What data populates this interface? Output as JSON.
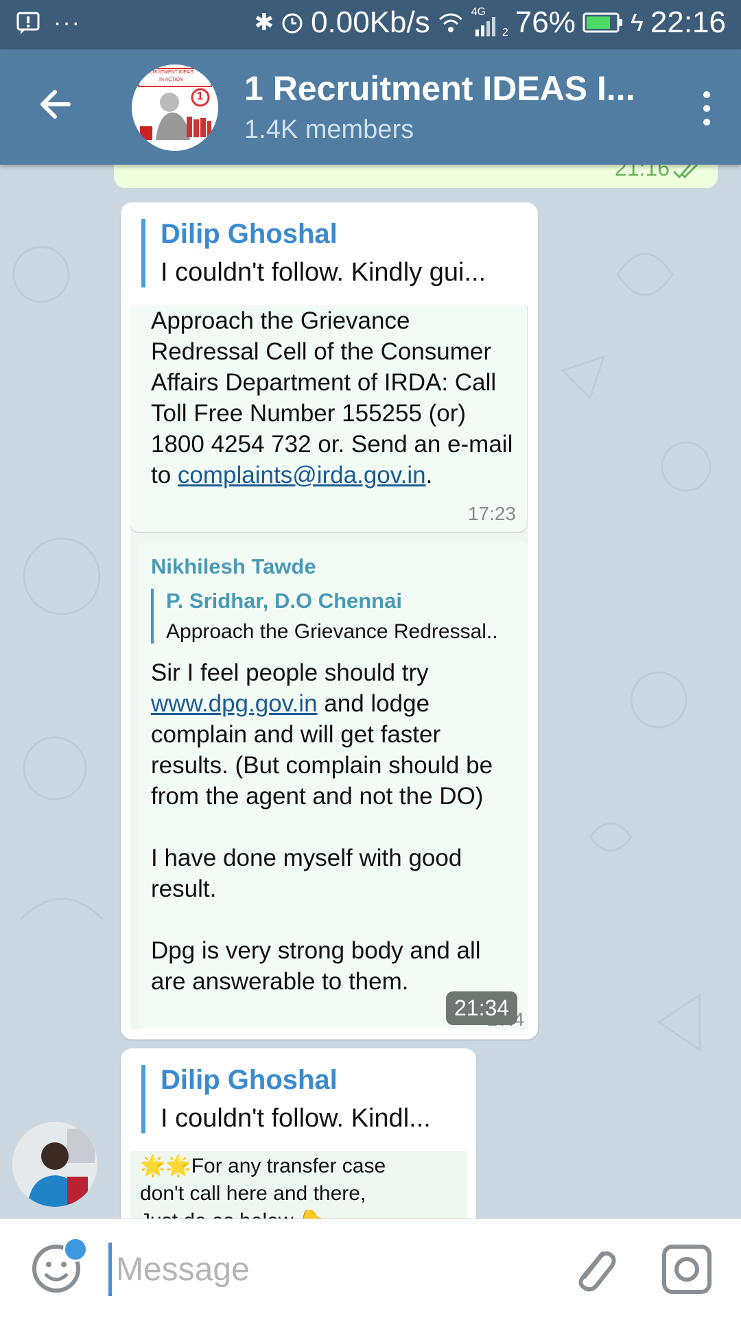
{
  "statusbar": {
    "network": "0.00Kb/s",
    "signal_label": "4G",
    "sim": "2",
    "battery": "76%",
    "time": "22:16"
  },
  "header": {
    "title": "1 Recruitment IDEAS I...",
    "subtitle": "1.4K members",
    "avatar_text_top": "RECRUITMENT IDEAS",
    "avatar_text_bottom": "IN ACTION",
    "avatar_badge": "1"
  },
  "outgoing": {
    "time": "21:16"
  },
  "messages": [
    {
      "reply_name": "Dilip Ghoshal",
      "reply_text": "I couldn't follow. Kindly gui...",
      "shot": {
        "paragraph_start": "Approach the Grievance Redressal Cell of the Consumer Affairs Department of IRDA: Call Toll Free Number 155255 (or) 1800 4254 732 or. Send an e-mail to ",
        "email": "complaints@irda.gov.in",
        "paragraph_end": ".",
        "time": "17:23",
        "inner": {
          "sender": "Nikhilesh Tawde",
          "nested_name": "P. Sridhar, D.O Chennai",
          "nested_text": "Approach the Grievance Redressal..",
          "line1_start": "Sir I feel people should try ",
          "line1_link": "www.dpg.gov.in",
          "line1_end": " and lodge complain and will get faster results. (But complain should be from the agent and not the DO)",
          "line2": "I have done myself with good result.",
          "line3": "Dpg is very strong body and all are answerable to them.",
          "faded_time": "17:4"
        }
      },
      "time": "21:34"
    },
    {
      "reply_name": "Dilip Ghoshal",
      "reply_text": "I couldn't follow. Kindl...",
      "shot_text": "🌟🌟For any transfer case don't call here and there,",
      "shot_text_cut": "Just do as below 👇"
    }
  ],
  "input": {
    "placeholder": "Message"
  },
  "colors": {
    "header": "#517da2",
    "statusbar": "#3d5c7a",
    "accent": "#3a8ad0",
    "chat_bg": "#cbd7e1"
  }
}
